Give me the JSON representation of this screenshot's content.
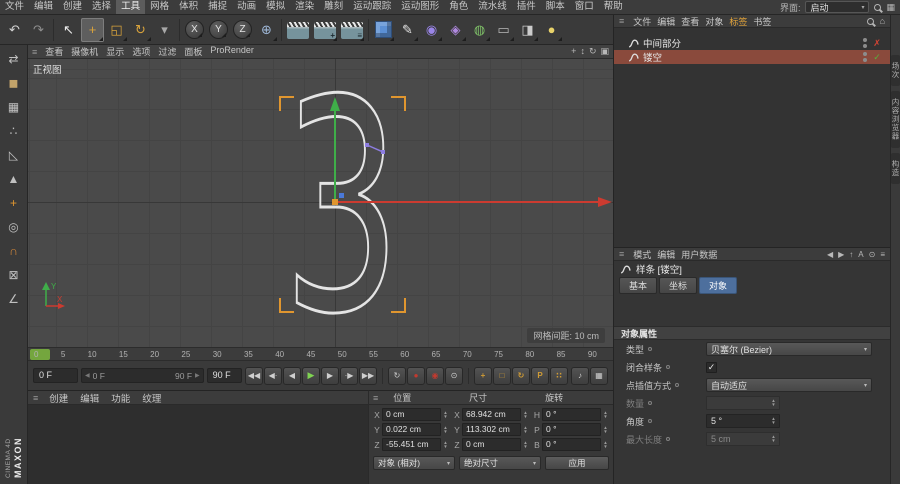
{
  "colors": {
    "accent_orange": "#e0962f",
    "axis_green": "#3fae49",
    "axis_red": "#cc3b30",
    "selection_blue": "#4d6f9d",
    "selected_row": "#8a4a3c",
    "play_green": "#74a63e",
    "gold": "#cf9b35",
    "record_red": "#c23a2f"
  },
  "icons": {
    "burger": "≡",
    "dd_arrow": "▾",
    "cap_left": "◀",
    "cap_right": "▶",
    "spin_up": "▲",
    "spin_down": "▼",
    "home": "⌂",
    "layout_grid": "▦"
  },
  "menubar": {
    "items": [
      {
        "label": "文件"
      },
      {
        "label": "编辑"
      },
      {
        "label": "创建"
      },
      {
        "label": "选择"
      },
      {
        "label": "工具",
        "cls": "hl"
      },
      {
        "label": "网格"
      },
      {
        "label": "体积"
      },
      {
        "label": "捕捉"
      },
      {
        "label": "动画"
      },
      {
        "label": "模拟"
      },
      {
        "label": "渲染"
      },
      {
        "label": "雕刻"
      },
      {
        "label": "运动跟踪"
      },
      {
        "label": "运动图形"
      },
      {
        "label": "角色"
      },
      {
        "label": "流水线"
      },
      {
        "label": "插件"
      },
      {
        "label": "脚本"
      },
      {
        "label": "窗口"
      },
      {
        "label": "帮助"
      }
    ],
    "interface_label": "界面:",
    "interface_value": "启动"
  },
  "toolbar": {
    "history": [
      {
        "name": "undo-icon",
        "glyph": "↶",
        "color": "#d2d2d2"
      },
      {
        "name": "redo-icon",
        "glyph": "↷",
        "color": "#8e8e8e"
      }
    ],
    "transform": [
      {
        "name": "live-select-icon",
        "glyph": "↖",
        "color": "#ececec"
      },
      {
        "name": "move-tool-icon",
        "glyph": "+",
        "color": "#d8a33c",
        "cls": "active hasdd"
      },
      {
        "name": "scale-tool-icon",
        "glyph": "◱",
        "color": "#d8a33c",
        "cls": "hasdd"
      },
      {
        "name": "rotate-tool-icon",
        "glyph": "↻",
        "color": "#d8a33c",
        "cls": "hasdd"
      },
      {
        "name": "last-tool-icon",
        "glyph": "▾",
        "color": "#a8a8a8"
      }
    ],
    "axis": [
      {
        "name": "x-axis-lock-button",
        "glyph": "X",
        "cls": "axisbtn hasdd"
      },
      {
        "name": "y-axis-lock-button",
        "glyph": "Y",
        "cls": "axisbtn hasdd"
      },
      {
        "name": "z-axis-lock-button",
        "glyph": "Z",
        "cls": "axisbtn hasdd"
      },
      {
        "name": "coordinate-system-button",
        "glyph": "⊕",
        "color": "#9fb8d8",
        "cls": "hasdd"
      }
    ],
    "render": [
      {
        "name": "render-view-button",
        "badge": ""
      },
      {
        "name": "render-picture-viewer-button",
        "badge": "+",
        "cls": "hasdd"
      },
      {
        "name": "render-settings-button",
        "badge": "≡",
        "cls": "hasdd"
      }
    ],
    "create": [
      {
        "name": "cube-primitive-button",
        "cls": "cube hasdd"
      },
      {
        "name": "spline-pen-button",
        "glyph": "✎",
        "color": "#e6e6e6",
        "cls": "hasdd"
      },
      {
        "name": "subdivision-surface-button",
        "glyph": "◉",
        "color": "#9a85e8",
        "cls": "hasdd"
      },
      {
        "name": "deformer-button",
        "glyph": "◈",
        "color": "#b089e0",
        "cls": "hasdd"
      },
      {
        "name": "generator-button",
        "glyph": "◍",
        "color": "#7fc168",
        "cls": "hasdd"
      },
      {
        "name": "floor-button",
        "glyph": "▭",
        "color": "#b8b8b8",
        "cls": "hasdd"
      },
      {
        "name": "camera-button",
        "glyph": "◨",
        "color": "#cccccc",
        "cls": "hasdd"
      },
      {
        "name": "light-button",
        "glyph": "●",
        "color": "#e8d26a",
        "cls": "hasdd"
      }
    ]
  },
  "left_toolbar": {
    "icons": [
      {
        "name": "make-editable-icon",
        "glyph": "⇄",
        "color": "#c0c0c0"
      },
      {
        "name": "model-mode-icon",
        "glyph": "◼",
        "color": "#c2a36a"
      },
      {
        "name": "texture-mode-icon",
        "glyph": "▦",
        "color": "#c0c0c0"
      },
      {
        "name": "points-mode-icon",
        "glyph": "∴",
        "color": "#c0c0c0"
      },
      {
        "name": "edges-mode-icon",
        "glyph": "◺",
        "color": "#c0c0c0"
      },
      {
        "name": "polygons-mode-icon",
        "glyph": "▲",
        "color": "#c0c0c0"
      },
      {
        "name": "axis-mode-icon",
        "glyph": "+",
        "color": "#e0962f"
      },
      {
        "name": "solo-mode-icon",
        "glyph": "◎",
        "color": "#c0c0c0"
      },
      {
        "name": "snap-icon",
        "glyph": "∩",
        "color": "#d98a3a"
      },
      {
        "name": "lock-workplane-icon",
        "glyph": "⊠",
        "color": "#c0c0c0"
      },
      {
        "name": "quantize-icon",
        "glyph": "∠",
        "color": "#c0c0c0"
      }
    ]
  },
  "viewport": {
    "menu": [
      {
        "label": "查看"
      },
      {
        "label": "摄像机"
      },
      {
        "label": "显示"
      },
      {
        "label": "选项"
      },
      {
        "label": "过滤"
      },
      {
        "label": "面板"
      },
      {
        "label": "ProRender"
      }
    ],
    "corner_icons": [
      {
        "name": "vp-pan-icon",
        "glyph": "+"
      },
      {
        "name": "vp-zoom-icon",
        "glyph": "↕"
      },
      {
        "name": "vp-rotate-icon",
        "glyph": "↻"
      },
      {
        "name": "vp-toggle-icon",
        "glyph": "▣"
      }
    ],
    "view_label": "正视图",
    "grid_label": "网格间距: 10 cm",
    "spline_text": "3",
    "gizmo_y": "Y",
    "gizmo_x": "X"
  },
  "timeline": {
    "ticks": [
      "0",
      "5",
      "10",
      "15",
      "20",
      "25",
      "30",
      "35",
      "40",
      "45",
      "50",
      "55",
      "60",
      "65",
      "70",
      "75",
      "80",
      "85",
      "90"
    ]
  },
  "transport": {
    "current": "0 F",
    "range_start": "0 F",
    "range_end": "90 F",
    "end": "90 F",
    "play_buttons": [
      {
        "name": "goto-start-button",
        "glyph": "◀◀"
      },
      {
        "name": "prev-key-button",
        "glyph": "◀·"
      },
      {
        "name": "prev-frame-button",
        "glyph": "◀"
      },
      {
        "name": "play-button",
        "glyph": "▶",
        "cls": "play"
      },
      {
        "name": "next-frame-button",
        "glyph": "▶"
      },
      {
        "name": "next-key-button",
        "glyph": "·▶"
      },
      {
        "name": "goto-end-button",
        "glyph": "▶▶"
      }
    ],
    "record_buttons": [
      {
        "name": "loop-mode-button",
        "glyph": "↻"
      },
      {
        "name": "record-keyframe-button",
        "glyph": "●",
        "cls": "rec"
      },
      {
        "name": "autokey-button",
        "glyph": "◉",
        "cls": "rec"
      },
      {
        "name": "keyframe-selection-button",
        "glyph": "⊙"
      }
    ],
    "key_toggles": [
      {
        "name": "key-position-toggle",
        "glyph": "+",
        "cls": "gold"
      },
      {
        "name": "key-scale-toggle",
        "glyph": "□",
        "cls": "gold"
      },
      {
        "name": "key-rotation-toggle",
        "glyph": "↻",
        "cls": "gold"
      },
      {
        "name": "key-parameter-toggle",
        "glyph": "P",
        "cls": "gold"
      },
      {
        "name": "key-pla-toggle",
        "glyph": "∷",
        "cls": "gold"
      }
    ],
    "misc_buttons": [
      {
        "name": "sound-toggle",
        "glyph": "♪"
      },
      {
        "name": "timeline-layout-button",
        "glyph": "▦"
      }
    ]
  },
  "material_panel": {
    "tabs": [
      {
        "label": "创建"
      },
      {
        "label": "编辑"
      },
      {
        "label": "功能"
      },
      {
        "label": "纹理"
      }
    ]
  },
  "brand": {
    "line1": "MAXON",
    "line2": "CINEMA 4D"
  },
  "coords": {
    "headers": [
      "位置",
      "尺寸",
      "旋转"
    ],
    "rows": [
      {
        "l1": "X",
        "v1": "0 cm",
        "l2": "X",
        "v2": "68.942 cm",
        "l3": "H",
        "v3": "0 °"
      },
      {
        "l1": "Y",
        "v1": "0.022 cm",
        "l2": "Y",
        "v2": "113.302 cm",
        "l3": "P",
        "v3": "0 °"
      },
      {
        "l1": "Z",
        "v1": "-55.451 cm",
        "l2": "Z",
        "v2": "0 cm",
        "l3": "B",
        "v3": "0 °"
      }
    ],
    "mode_object": "对象 (相对)",
    "mode_size": "绝对尺寸",
    "apply_label": "应用"
  },
  "object_manager": {
    "menu": [
      {
        "label": "文件"
      },
      {
        "label": "编辑"
      },
      {
        "label": "查看"
      },
      {
        "label": "对象"
      },
      {
        "label": "标签",
        "cls": "accent"
      },
      {
        "label": "书签"
      }
    ],
    "objects": [
      {
        "name": "中间部分",
        "mark": "✗",
        "mark_cls": "off"
      },
      {
        "name": "镂空",
        "mark": "✓",
        "mark_cls": "on",
        "row_cls": "selected"
      }
    ]
  },
  "attributes": {
    "menu": [
      {
        "label": "模式"
      },
      {
        "label": "编辑"
      },
      {
        "label": "用户数据"
      }
    ],
    "right_icons": [
      {
        "name": "nav-back-icon",
        "glyph": "◀"
      },
      {
        "name": "nav-forward-icon",
        "glyph": "▶"
      },
      {
        "name": "history-icon",
        "glyph": "↑"
      },
      {
        "name": "mode-a-icon",
        "glyph": "A"
      },
      {
        "name": "lock-icon",
        "glyph": "⊙"
      },
      {
        "name": "panel-menu-icon",
        "glyph": "≡"
      }
    ],
    "title": "样条 [镂空]",
    "tabs": [
      {
        "label": "基本"
      },
      {
        "label": "坐标"
      },
      {
        "label": "对象",
        "cls": "active"
      }
    ],
    "section_title": "对象属性",
    "type_label": "类型",
    "type_value": "贝塞尔 (Bezier)",
    "close_label": "闭合样条",
    "close_checked": "✓",
    "interp_label": "点插值方式",
    "interp_value": "自动适应",
    "count_label": "数量",
    "count_value": "",
    "angle_label": "角度",
    "angle_value": "5 °",
    "maxlen_label": "最大长度",
    "maxlen_value": "5 cm"
  },
  "side_tabs": [
    {
      "label": "场次"
    },
    {
      "label": "内容浏览器"
    },
    {
      "label": "构造"
    }
  ]
}
